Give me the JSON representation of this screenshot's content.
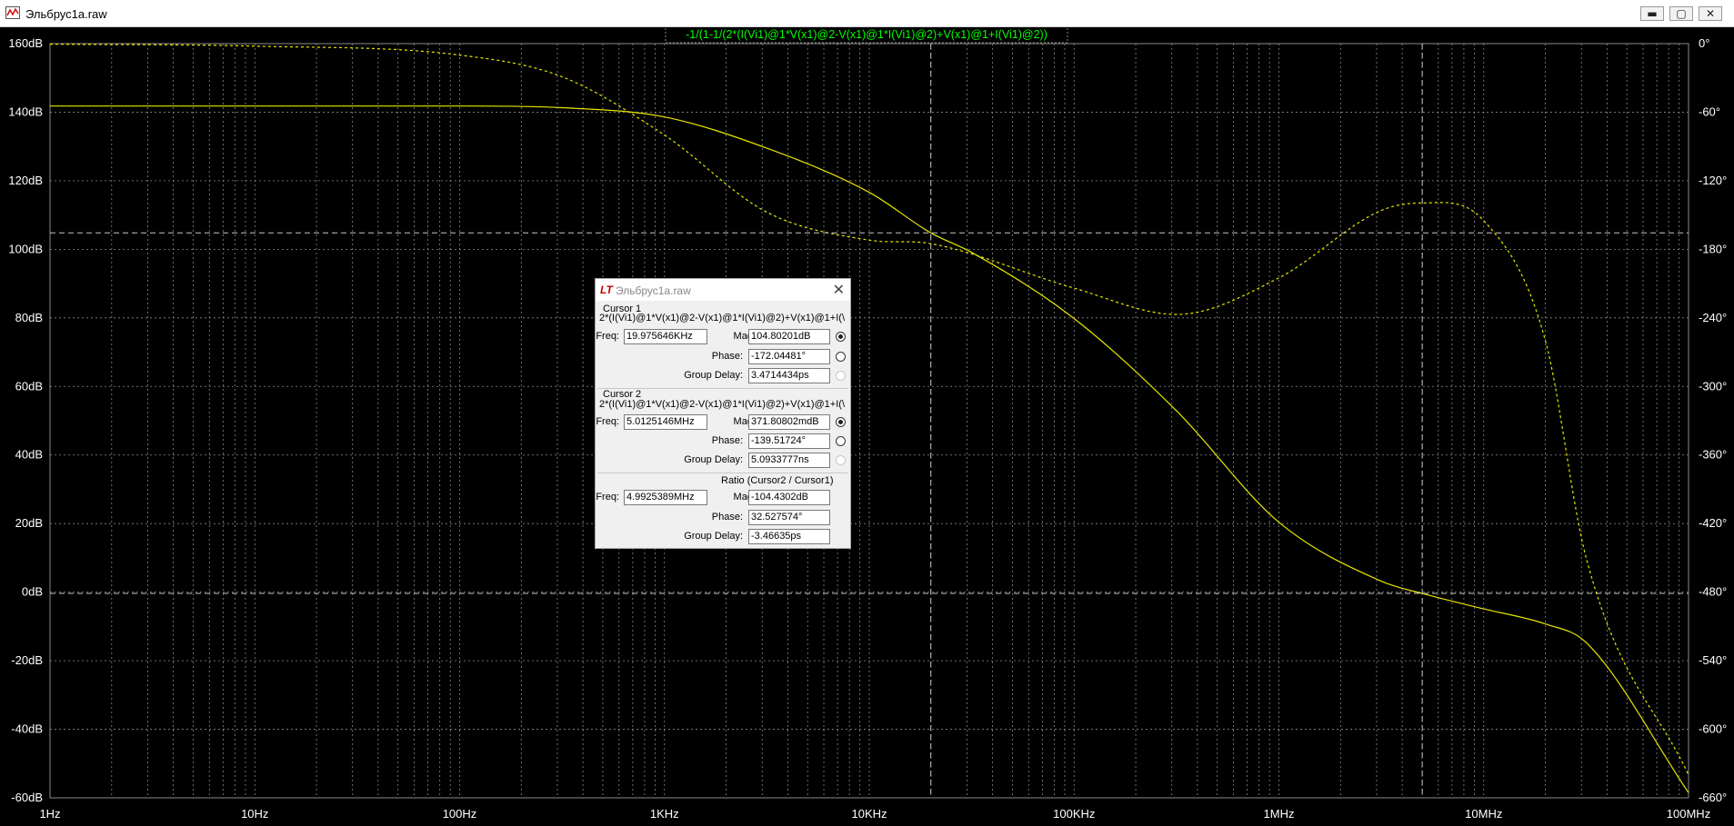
{
  "window": {
    "title": "Эльбрус1a.raw",
    "buttons": {
      "minimize": "▬",
      "maximize": "▢",
      "close": "✕"
    }
  },
  "trace_label": "-1/(1-1/(2*(I(Vi1)@1*V(x1)@2-V(x1)@1*I(Vi1)@2)+V(x1)@1+I(Vi1)@2))",
  "colors": {
    "background": "#000000",
    "trace": "#e6e600",
    "trace_label": "#00ff00",
    "grid": "#8a8a8a",
    "cursor": "#c8c8c8",
    "axis_text": "#ffffff"
  },
  "chart_data": {
    "type": "line",
    "x_scale": "log",
    "xlim": [
      1,
      100000000
    ],
    "ylim_left": [
      -60,
      160
    ],
    "ylim_right": [
      -660,
      0
    ],
    "x_tick_labels": [
      "1Hz",
      "10Hz",
      "100Hz",
      "1KHz",
      "10KHz",
      "100KHz",
      "1MHz",
      "10MHz",
      "100MHz"
    ],
    "x_tick_values": [
      1,
      10,
      100,
      1000,
      10000,
      100000,
      1000000,
      10000000,
      100000000
    ],
    "y_left_tick_labels": [
      "160dB",
      "140dB",
      "120dB",
      "100dB",
      "80dB",
      "60dB",
      "40dB",
      "20dB",
      "0dB",
      "-20dB",
      "-40dB",
      "-60dB"
    ],
    "y_left_tick_values": [
      160,
      140,
      120,
      100,
      80,
      60,
      40,
      20,
      0,
      -20,
      -40,
      -60
    ],
    "y_right_tick_labels": [
      "0°",
      "-60°",
      "-120°",
      "-180°",
      "-240°",
      "-300°",
      "-360°",
      "-420°",
      "-480°",
      "-540°",
      "-600°",
      "-660°"
    ],
    "y_right_tick_values": [
      0,
      -60,
      -120,
      -180,
      -240,
      -300,
      -360,
      -420,
      -480,
      -540,
      -600,
      -660
    ],
    "grid": true,
    "series": [
      {
        "style": "solid",
        "axis": "left",
        "x": [
          1,
          10,
          100,
          316,
          1000,
          3162,
          10000,
          19976,
          31623,
          100000,
          316228,
          1000000,
          3162278,
          5012515,
          10000000,
          20000000,
          31623000,
          100000000
        ],
        "y": [
          141.8,
          141.8,
          141.8,
          141.3,
          138.6,
          129.5,
          116.6,
          104.8,
          99.1,
          79.8,
          52.9,
          20.4,
          3.2,
          -0.4,
          -4.9,
          -9.3,
          -14.7,
          -58.5
        ]
      },
      {
        "style": "dashed",
        "axis": "right",
        "x": [
          1,
          10,
          100,
          316,
          1000,
          3162,
          10000,
          19976,
          100000,
          316228,
          1000000,
          3162278,
          5012515,
          10000000,
          20000000,
          31623000,
          100000000
        ],
        "y": [
          -0.5,
          -2.2,
          -10,
          -29,
          -80,
          -147.5,
          -172,
          -175,
          -214,
          -237,
          -205,
          -146,
          -139.5,
          -155,
          -260,
          -450,
          -640
        ]
      }
    ],
    "cursors": [
      {
        "name": "Cursor 1",
        "x": 19976,
        "y": 104.8,
        "y_phase": -172.04
      },
      {
        "name": "Cursor 2",
        "x": 5012515,
        "y": -0.372,
        "y_phase": -139.52
      }
    ]
  },
  "dialog": {
    "title": "Эльбрус1a.raw",
    "logo": "LT",
    "close": "✕",
    "cursor1": {
      "heading": "Cursor 1",
      "expr": "2*(I(Vi1)@1*V(x1)@2-V(x1)@1*I(Vi1)@2)+V(x1)@1+I(\\",
      "freq_label": "Freq:",
      "freq": "19.975646KHz",
      "mag_label": "Mag:",
      "mag": "104.80201dB",
      "phase_label": "Phase:",
      "phase": "-172.04481°",
      "gd_label": "Group Delay:",
      "gd": "3.4714434ps"
    },
    "cursor2": {
      "heading": "Cursor 2",
      "expr": "2*(I(Vi1)@1*V(x1)@2-V(x1)@1*I(Vi1)@2)+V(x1)@1+I(\\",
      "freq_label": "Freq:",
      "freq": "5.0125146MHz",
      "mag_label": "Mag:",
      "mag": "371.80802mdB",
      "phase_label": "Phase:",
      "phase": "-139.51724°",
      "gd_label": "Group Delay:",
      "gd": "5.0933777ns"
    },
    "ratio": {
      "heading": "Ratio (Cursor2 / Cursor1)",
      "freq_label": "Freq:",
      "freq": "4.9925389MHz",
      "mag_label": "Mag:",
      "mag": "-104.4302dB",
      "phase_label": "Phase:",
      "phase": "32.527574°",
      "gd_label": "Group Delay:",
      "gd": "-3.46635ps"
    }
  }
}
